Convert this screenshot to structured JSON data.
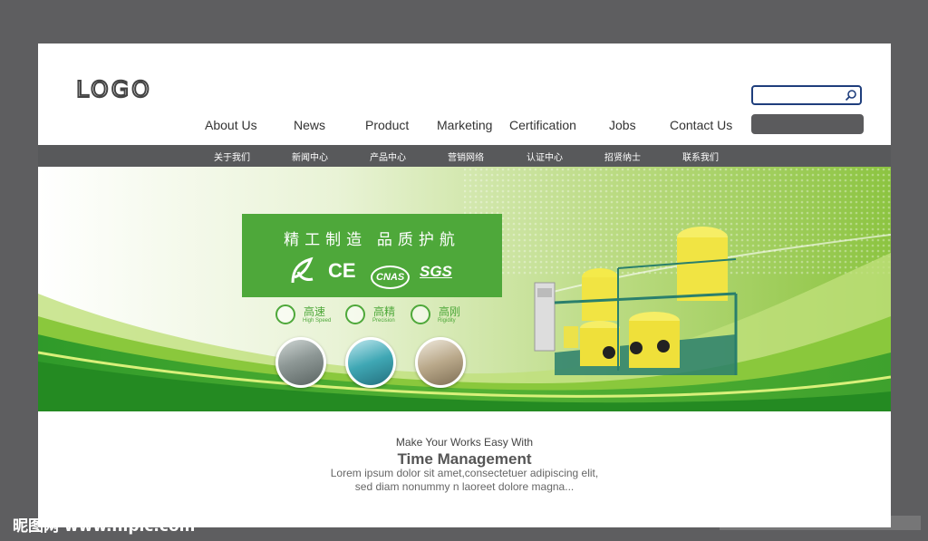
{
  "header": {
    "logo": "LOGO",
    "search": {
      "value": ""
    }
  },
  "nav": {
    "en": [
      "About Us",
      "News",
      "Product",
      "Marketing",
      "Certification",
      "Jobs",
      "Contact Us"
    ],
    "zh": [
      "关于我们",
      "新闻中心",
      "产品中心",
      "营销网络",
      "认证中心",
      "招贤纳士",
      "联系我们"
    ]
  },
  "banner": {
    "slogan": "精工制造  品质护航",
    "certs": [
      "CE",
      "CNAS",
      "SGS"
    ],
    "features": [
      {
        "zh": "高速",
        "en": "High Speed"
      },
      {
        "zh": "高精",
        "en": "Precision"
      },
      {
        "zh": "高刚",
        "en": "Rigidity"
      }
    ]
  },
  "intro": {
    "kicker": "Make Your Works Easy With",
    "title": "Time Management",
    "body_line1": "Lorem ipsum dolor sit amet,consectetuer adipiscing elit,",
    "body_line2": "sed diam nonummy n laoreet dolore magna..."
  },
  "watermark": {
    "left": "昵图网 www.nipic.com",
    "right": "ID:8051772 NO:20210105210633045000"
  },
  "colors": {
    "page_bg": "#5e5e60",
    "subnav_bg": "#58595b",
    "accent_green": "#4ea83a",
    "search_border": "#1f3e7c"
  }
}
